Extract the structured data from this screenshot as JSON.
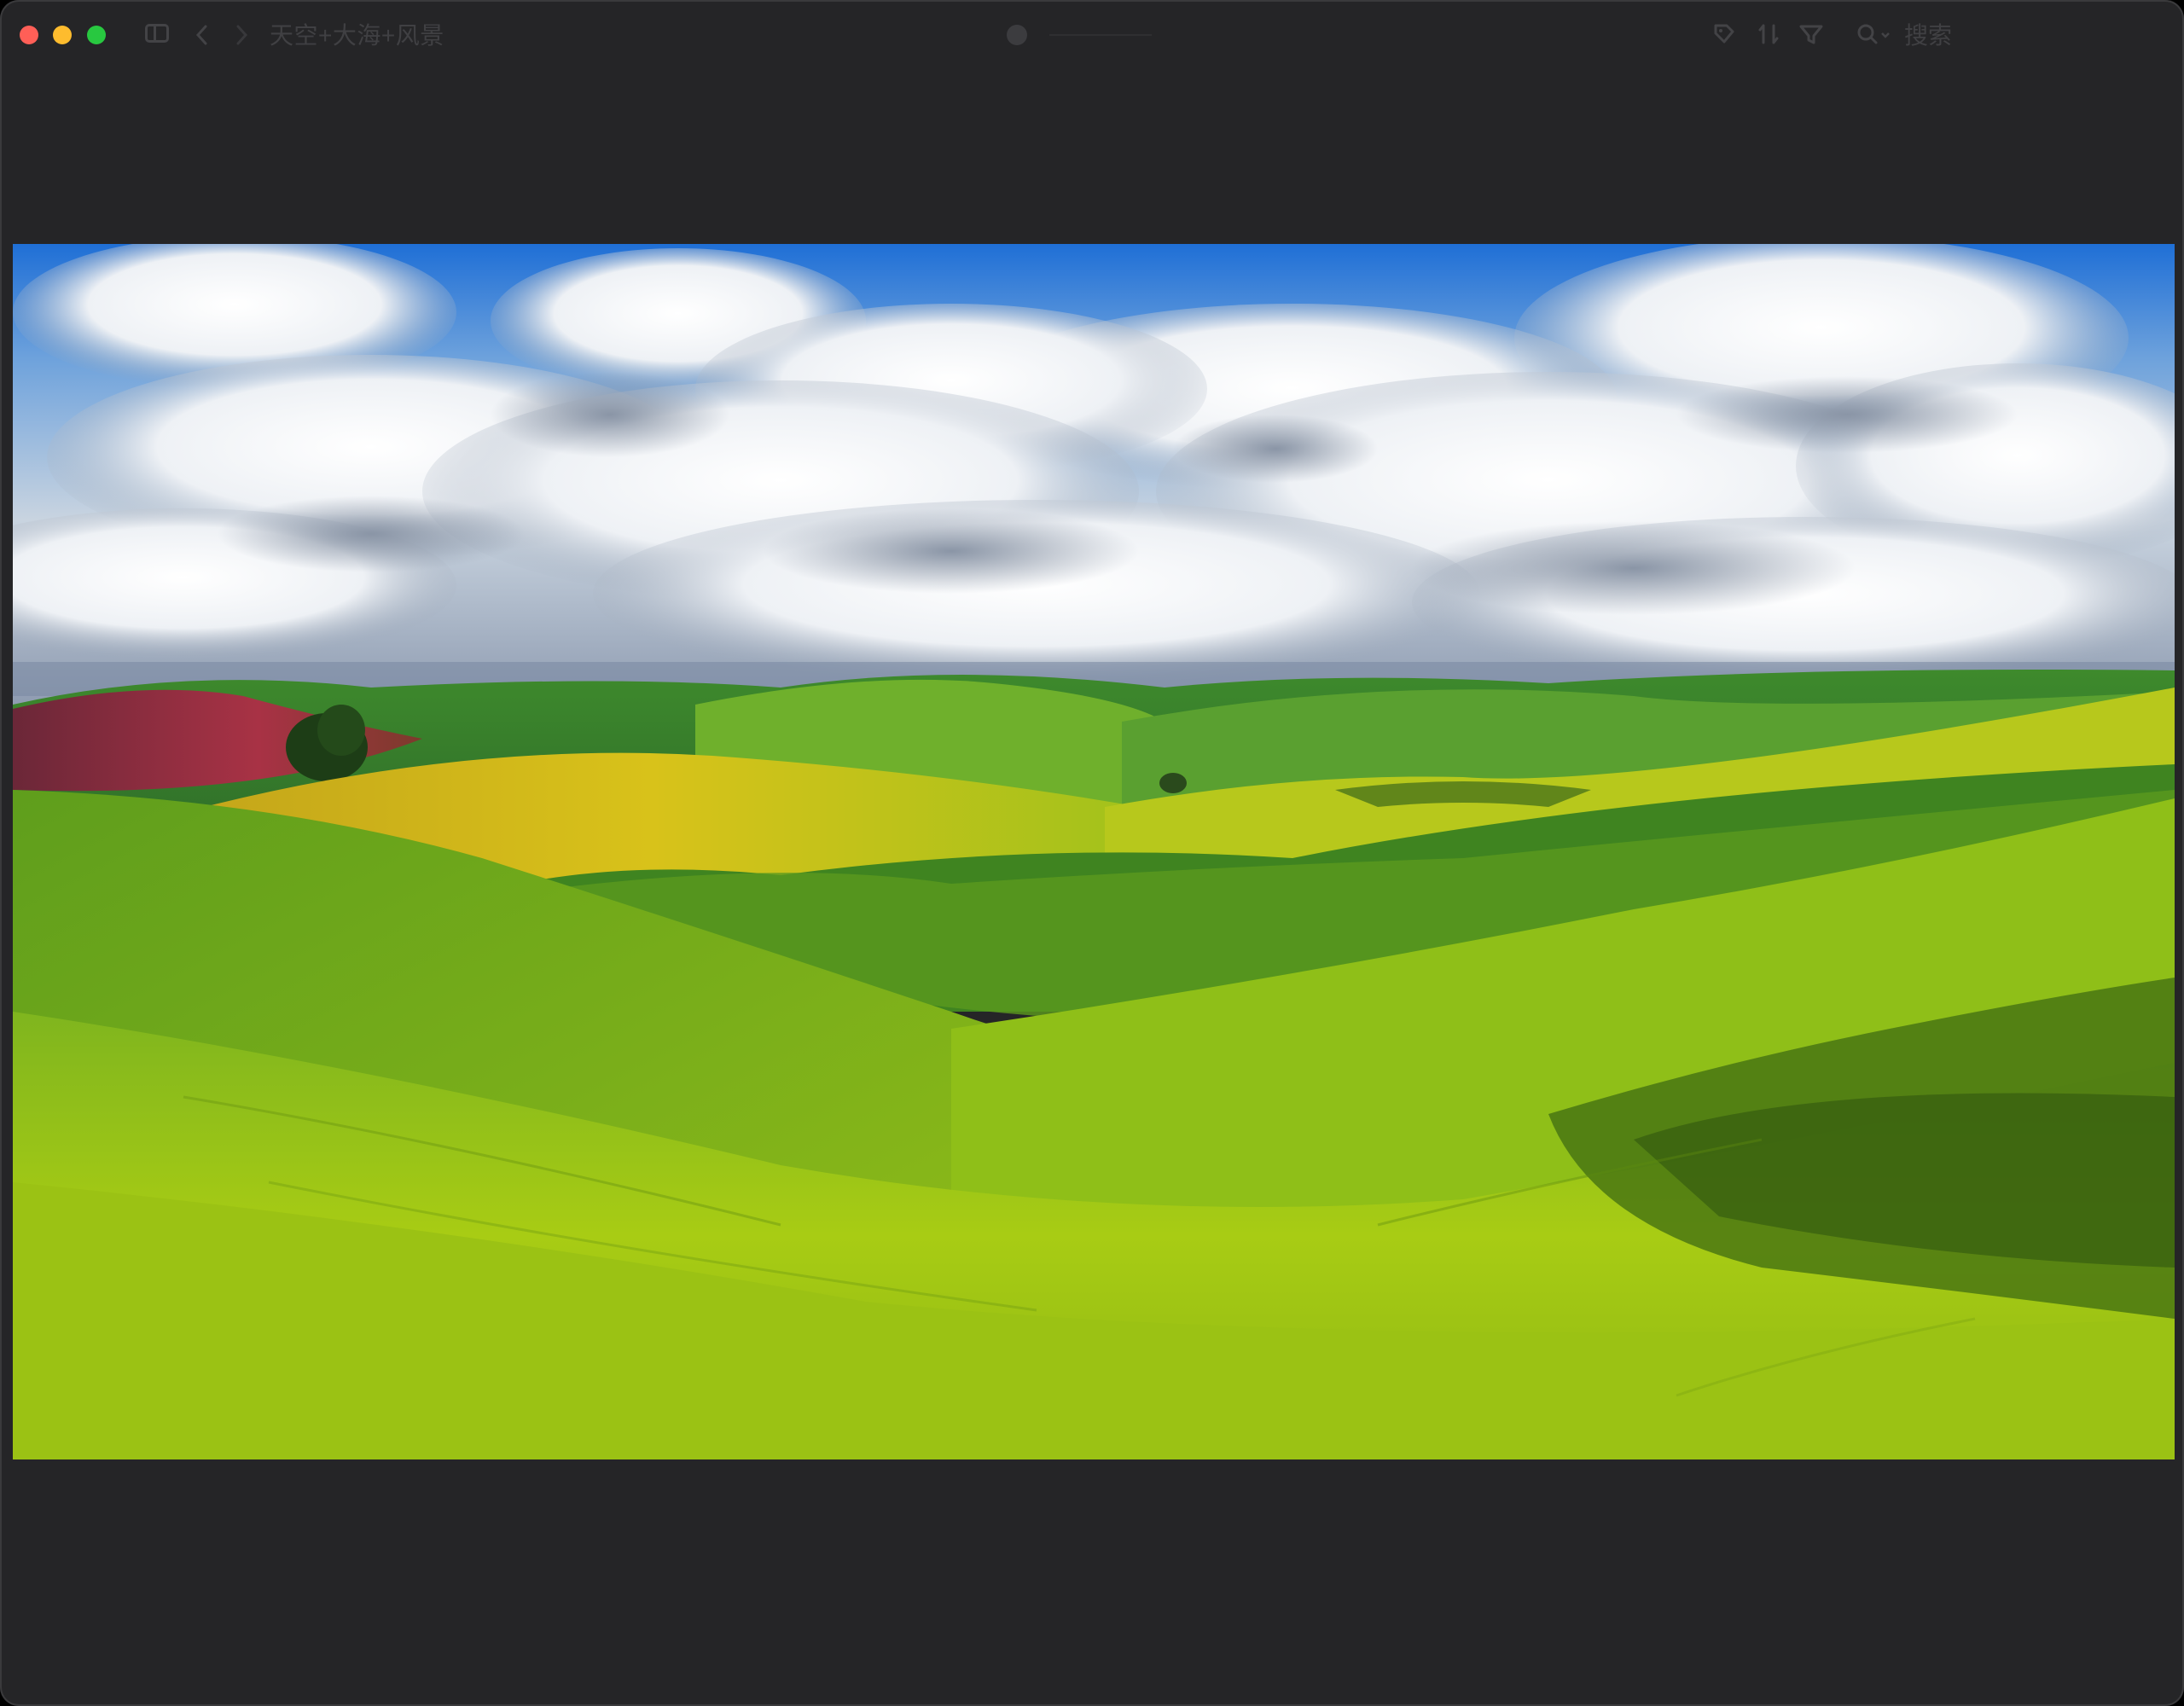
{
  "window": {
    "title": "天空+大海+风景",
    "controls": [
      "close",
      "minimize",
      "maximize"
    ]
  },
  "toolbar": {
    "search_placeholder": "搜索",
    "icons": [
      "sidebar-toggle-icon",
      "back-icon",
      "forward-icon",
      "tag-icon",
      "sort-icon",
      "filter-icon",
      "search-icon"
    ]
  },
  "image": {
    "subject": "landscape-photo"
  },
  "colors": {
    "window_bg": "#252527",
    "close": "#ff5f57",
    "minimize": "#febc2e",
    "maximize": "#28c840"
  }
}
